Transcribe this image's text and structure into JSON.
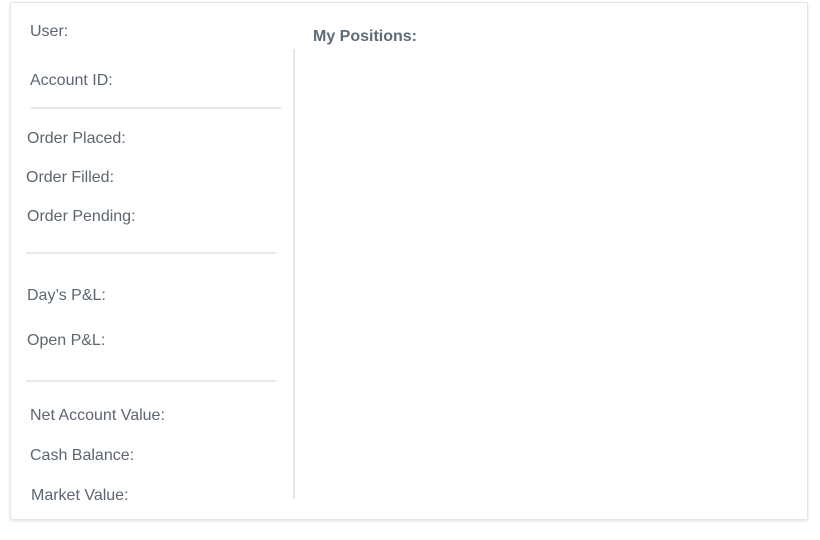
{
  "account_summary": {
    "user_label": "User:",
    "account_id_label": "Account ID:",
    "orders": {
      "placed_label": "Order Placed:",
      "filled_label": "Order Filled:",
      "pending_label": "Order Pending:"
    },
    "pnl": {
      "days_label": "Day’s P&L:",
      "open_label": "Open P&L:"
    },
    "balances": {
      "net_account_value_label": "Net Account Value:",
      "cash_balance_label": "Cash Balance:",
      "market_value_label": "Market Value:"
    }
  },
  "positions": {
    "title": "My Positions:"
  }
}
